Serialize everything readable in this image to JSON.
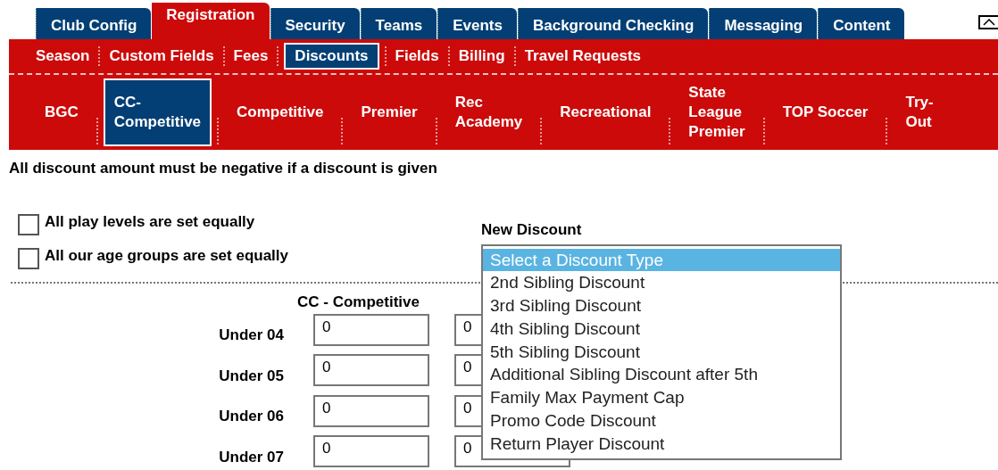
{
  "main_tabs": [
    {
      "label": "Club Config",
      "selected": false
    },
    {
      "label": "Registration",
      "selected": true
    },
    {
      "label": "Security",
      "selected": false
    },
    {
      "label": "Teams",
      "selected": false
    },
    {
      "label": "Events",
      "selected": false
    },
    {
      "label": "Background Checking",
      "selected": false
    },
    {
      "label": "Messaging",
      "selected": false
    },
    {
      "label": "Content",
      "selected": false
    }
  ],
  "sub_tabs": [
    {
      "label": "Season",
      "selected": false
    },
    {
      "label": "Custom Fields",
      "selected": false
    },
    {
      "label": "Fees",
      "selected": false
    },
    {
      "label": "Discounts",
      "selected": true
    },
    {
      "label": "Fields",
      "selected": false
    },
    {
      "label": "Billing",
      "selected": false
    },
    {
      "label": "Travel Requests",
      "selected": false
    }
  ],
  "level_tabs": [
    {
      "label": "BGC",
      "selected": false
    },
    {
      "label": "CC-\nCompetitive",
      "selected": true
    },
    {
      "label": "Competitive",
      "selected": false
    },
    {
      "label": "Premier",
      "selected": false
    },
    {
      "label": "Rec\nAcademy",
      "selected": false
    },
    {
      "label": "Recreational",
      "selected": false
    },
    {
      "label": "State\nLeague\nPremier",
      "selected": false
    },
    {
      "label": "TOP Soccer",
      "selected": false
    },
    {
      "label": "Try-\nOut",
      "selected": false
    }
  ],
  "notice": "All discount amount must be negative if a discount is given",
  "options": [
    {
      "label": "All play levels are set equally",
      "checked": false
    },
    {
      "label": "All our age groups are set equally",
      "checked": false
    }
  ],
  "new_discount": {
    "label": "New Discount",
    "items": [
      {
        "label": "Select a Discount Type",
        "selected": true
      },
      {
        "label": "2nd Sibling Discount",
        "selected": false
      },
      {
        "label": "3rd Sibling Discount",
        "selected": false
      },
      {
        "label": "4th Sibling Discount",
        "selected": false
      },
      {
        "label": "5th Sibling Discount",
        "selected": false
      },
      {
        "label": "Additional Sibling Discount after 5th",
        "selected": false
      },
      {
        "label": "Family Max Payment Cap",
        "selected": false
      },
      {
        "label": "Promo Code Discount",
        "selected": false
      },
      {
        "label": "Return Player Discount",
        "selected": false
      }
    ]
  },
  "table": {
    "column_1": "CC - Competitive",
    "rows": [
      {
        "age": "Under 04",
        "values": [
          "0",
          "0"
        ]
      },
      {
        "age": "Under 05",
        "values": [
          "0",
          "0"
        ]
      },
      {
        "age": "Under 06",
        "values": [
          "0",
          "0"
        ]
      },
      {
        "age": "Under 07",
        "values": [
          "0",
          "0"
        ]
      }
    ]
  }
}
